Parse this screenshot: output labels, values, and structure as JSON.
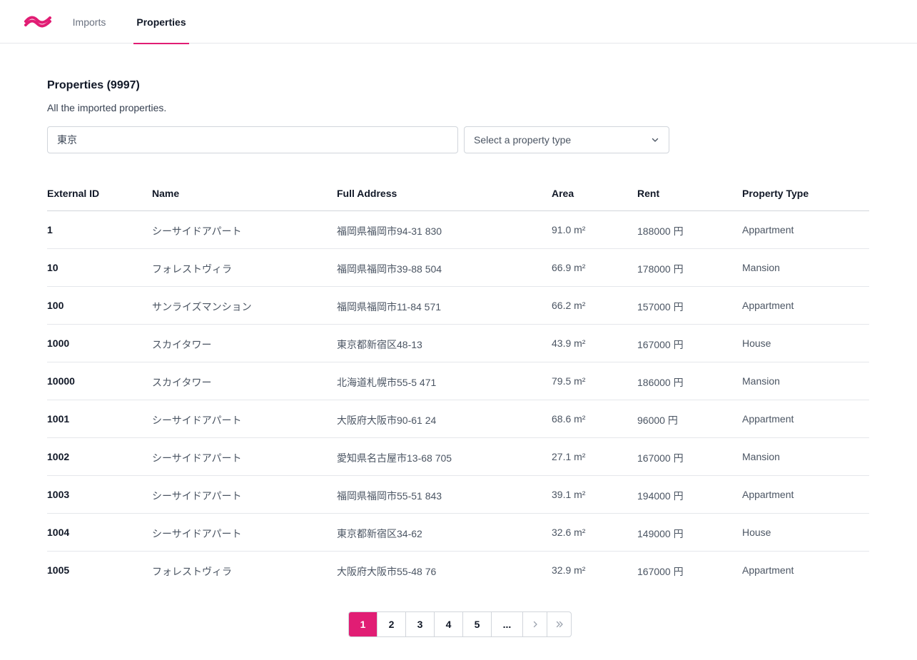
{
  "nav": {
    "logo": "tailwind-wave-logo",
    "tabs": [
      {
        "label": "Imports",
        "active": false
      },
      {
        "label": "Properties",
        "active": true
      }
    ],
    "accent_color": "#e11d74"
  },
  "header": {
    "title": "Properties (9997)",
    "subtitle": "All the imported properties."
  },
  "filters": {
    "search_value": "東京",
    "type_select_label": "Select a property type"
  },
  "table": {
    "columns": [
      "External ID",
      "Name",
      "Full Address",
      "Area",
      "Rent",
      "Property Type"
    ],
    "rows": [
      {
        "id": "1",
        "name": "シーサイドアパート",
        "address": "福岡県福岡市94-31 830",
        "area": "91.0 m²",
        "rent": "188000 円",
        "type": "Appartment"
      },
      {
        "id": "10",
        "name": "フォレストヴィラ",
        "address": "福岡県福岡市39-88 504",
        "area": "66.9 m²",
        "rent": "178000 円",
        "type": "Mansion"
      },
      {
        "id": "100",
        "name": "サンライズマンション",
        "address": "福岡県福岡市11-84 571",
        "area": "66.2 m²",
        "rent": "157000 円",
        "type": "Appartment"
      },
      {
        "id": "1000",
        "name": "スカイタワー",
        "address": "東京都新宿区48-13",
        "area": "43.9 m²",
        "rent": "167000 円",
        "type": "House"
      },
      {
        "id": "10000",
        "name": "スカイタワー",
        "address": "北海道札幌市55-5 471",
        "area": "79.5 m²",
        "rent": "186000 円",
        "type": "Mansion"
      },
      {
        "id": "1001",
        "name": "シーサイドアパート",
        "address": "大阪府大阪市90-61 24",
        "area": "68.6 m²",
        "rent": "96000 円",
        "type": "Appartment"
      },
      {
        "id": "1002",
        "name": "シーサイドアパート",
        "address": "愛知県名古屋市13-68 705",
        "area": "27.1 m²",
        "rent": "167000 円",
        "type": "Mansion"
      },
      {
        "id": "1003",
        "name": "シーサイドアパート",
        "address": "福岡県福岡市55-51 843",
        "area": "39.1 m²",
        "rent": "194000 円",
        "type": "Appartment"
      },
      {
        "id": "1004",
        "name": "シーサイドアパート",
        "address": "東京都新宿区34-62",
        "area": "32.6 m²",
        "rent": "149000 円",
        "type": "House"
      },
      {
        "id": "1005",
        "name": "フォレストヴィラ",
        "address": "大阪府大阪市55-48 76",
        "area": "32.9 m²",
        "rent": "167000 円",
        "type": "Appartment"
      }
    ]
  },
  "pagination": {
    "pages": [
      "1",
      "2",
      "3",
      "4",
      "5"
    ],
    "current": "1",
    "ellipsis": "...",
    "next_icon": "chevron-right-icon",
    "last_icon": "double-chevron-right-icon"
  }
}
